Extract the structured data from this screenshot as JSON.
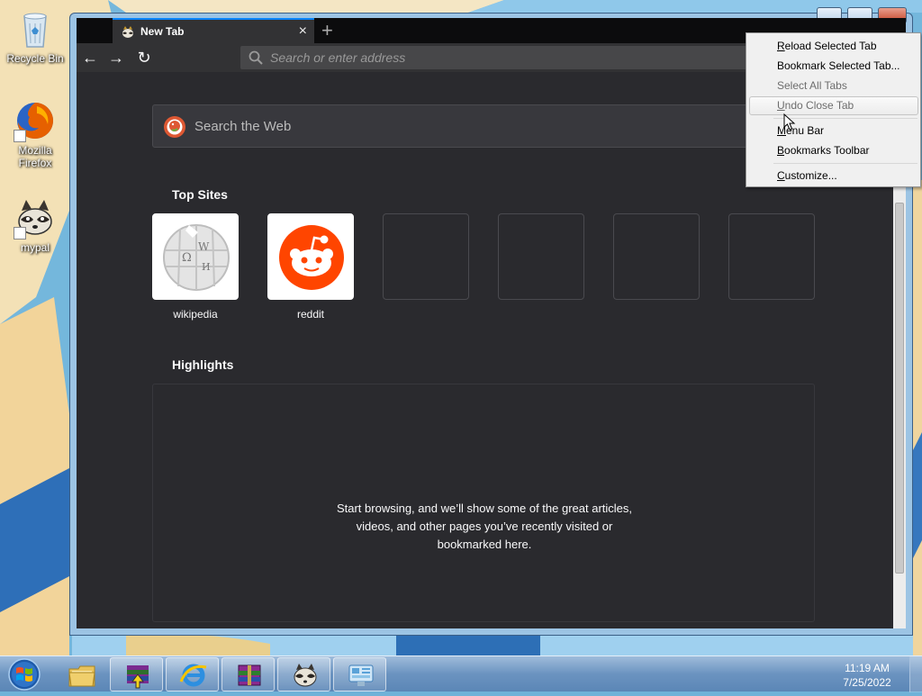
{
  "desktop": {
    "icons": [
      {
        "label": "Recycle Bin",
        "icon": "recycle-bin-icon"
      },
      {
        "label": "Mozilla Firefox",
        "icon": "firefox-icon"
      },
      {
        "label": "mypal",
        "icon": "mypal-icon"
      }
    ]
  },
  "browser": {
    "tab": {
      "title": "New Tab",
      "close": "×"
    },
    "new_tab": "+",
    "nav": {
      "back": "←",
      "forward": "→",
      "reload": "↻"
    },
    "urlbar": {
      "placeholder": "Search or enter address"
    },
    "newtab_page": {
      "search_placeholder": "Search the Web",
      "top_sites_title": "Top Sites",
      "top_sites": [
        {
          "label": "wikipedia",
          "icon": "wikipedia-icon"
        },
        {
          "label": "reddit",
          "icon": "reddit-icon"
        },
        {
          "label": ""
        },
        {
          "label": ""
        },
        {
          "label": ""
        },
        {
          "label": ""
        }
      ],
      "highlights_title": "Highlights",
      "highlights_empty": "Start browsing, and we’ll show some of the great articles, videos, and other pages you’ve recently visited or bookmarked here."
    }
  },
  "context_menu": {
    "items": [
      {
        "label": "Reload Selected Tab",
        "mnemonic": "R",
        "rest": "eload Selected Tab",
        "disabled": false
      },
      {
        "label": "Bookmark Selected Tab...",
        "mnemonic": "",
        "rest": "Bookmark Selected Tab...",
        "disabled": false
      },
      {
        "label": "Select All Tabs",
        "mnemonic": "",
        "rest": "Select All Tabs",
        "disabled": true
      },
      {
        "label": "Undo Close Tab",
        "mnemonic": "U",
        "rest": "ndo Close Tab",
        "disabled": true,
        "hovered": true
      },
      {
        "label": "Menu Bar",
        "mnemonic": "M",
        "rest": "enu Bar",
        "disabled": false
      },
      {
        "label": "Bookmarks Toolbar",
        "mnemonic": "B",
        "rest": "ookmarks Toolbar",
        "disabled": false
      },
      {
        "label": "Customize...",
        "mnemonic": "C",
        "rest": "ustomize...",
        "disabled": false
      }
    ]
  },
  "taskbar": {
    "pinned": [
      {
        "icon": "file-explorer-icon"
      },
      {
        "icon": "winrar-installer-icon"
      },
      {
        "icon": "internet-explorer-icon"
      },
      {
        "icon": "winrar-icon"
      },
      {
        "icon": "mypal-icon"
      },
      {
        "icon": "control-panel-icon"
      }
    ],
    "clock": {
      "time": "11:19 AM",
      "date": "7/25/2022"
    }
  },
  "colors": {
    "tab_accent": "#0a84ff",
    "content_bg": "#2a2a2e",
    "reddit_orange": "#ff4500",
    "firefox_orange": "#e66000"
  }
}
